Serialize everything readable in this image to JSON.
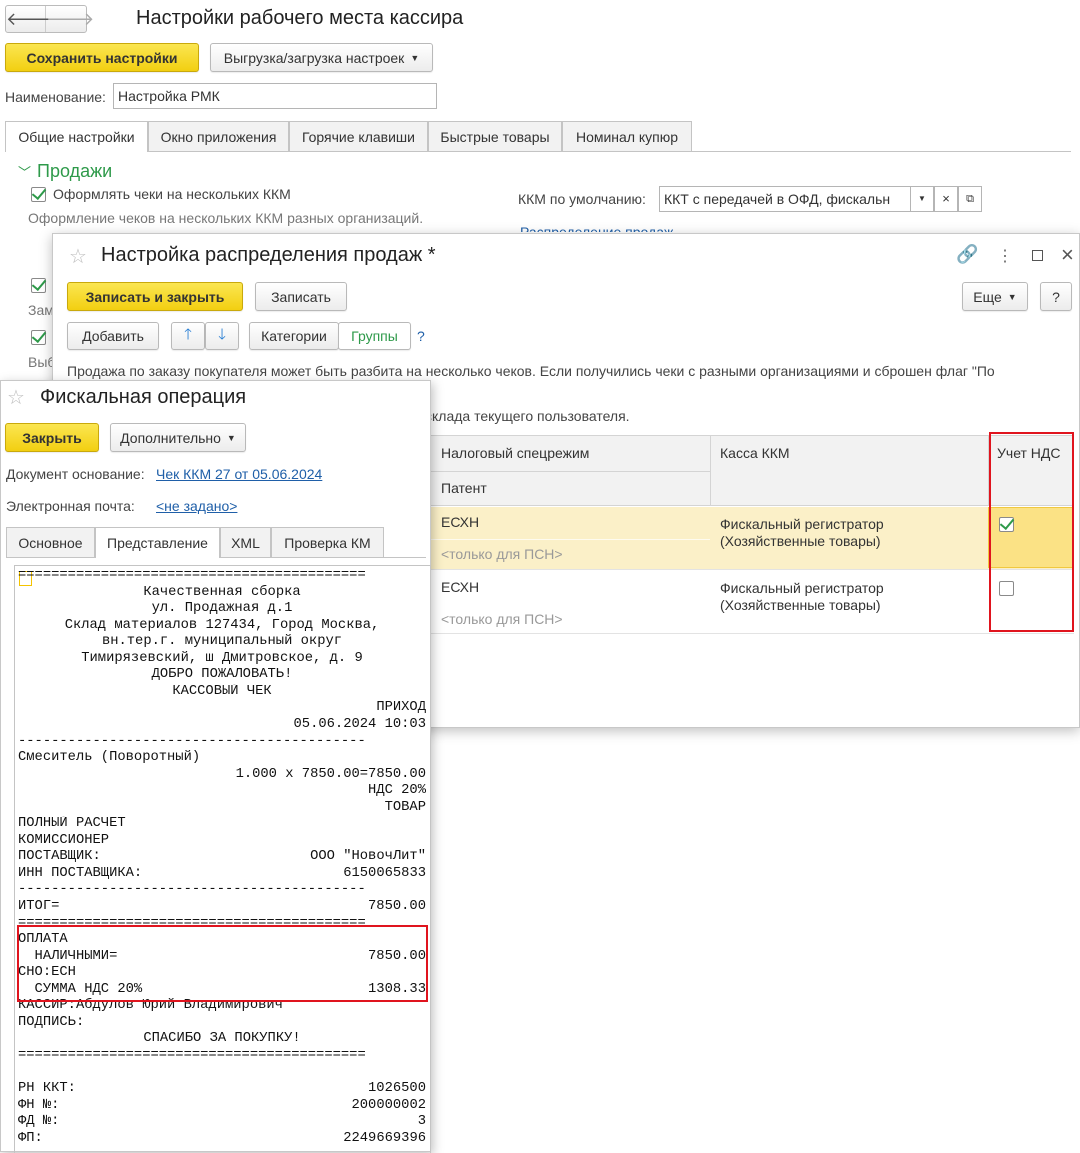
{
  "main": {
    "title": "Настройки рабочего места кассира",
    "save_label": "Сохранить настройки",
    "export_label": "Выгрузка/загрузка настроек",
    "name_label": "Наименование:",
    "name_value": "Настройка РМК",
    "tabs": [
      "Общие настройки",
      "Окно приложения",
      "Горячие клавиши",
      "Быстрые товары",
      "Номинал купюр"
    ],
    "section_title": "Продажи",
    "multi_kkm_label": "Оформлять чеки на нескольких ККМ",
    "multi_kkm_hint": "Оформление чеков на нескольких ККМ разных организаций.",
    "default_kkm_label": "ККМ по умолчанию:",
    "default_kkm_value": "ККТ с передачей в ОФД, фискальн",
    "partial_link": "Распределение продаж",
    "hidden_labels": [
      "Зам",
      "Выб"
    ]
  },
  "dist": {
    "title": "Настройка распределения продаж *",
    "write_close": "Записать и закрыть",
    "write": "Записать",
    "more": "Еще",
    "help": "?",
    "add": "Добавить",
    "categories": "Категории",
    "groups": "Группы",
    "q": "?",
    "info_line1": "Продажа по заказу покупателя может быть разбита на несколько чеков. Если получились чеки с разными организациями и сброшен флаг \"По",
    "info_line2": "склада текущего пользователя.",
    "columns": [
      "Налоговый спецрежим",
      "Касса ККМ",
      "Учет НДС"
    ],
    "subheader": "Патент",
    "rows": [
      {
        "regime": "ЕСХН",
        "patent": "<только для ПСН>",
        "kkm1": "Фискальный регистратор",
        "kkm2": "(Хозяйственные товары)",
        "vat": true
      },
      {
        "regime": "ЕСХН",
        "patent": "<только для ПСН>",
        "kkm1": "Фискальный регистратор",
        "kkm2": "(Хозяйственные товары)",
        "vat": false
      }
    ]
  },
  "fiscal": {
    "title": "Фискальная операция",
    "close": "Закрыть",
    "more": "Дополнительно",
    "doc_label": "Документ основание:",
    "doc_link": "Чек ККМ 27 от 05.06.2024",
    "email_label": "Электронная почта:",
    "email_link": "<не задано>",
    "tabs": [
      "Основное",
      "Представление",
      "XML",
      "Проверка КМ"
    ]
  },
  "receipt": [
    {
      "t": "==========================================",
      "a": "l"
    },
    {
      "t": "Качественная сборка",
      "a": "c"
    },
    {
      "t": "ул. Продажная д.1",
      "a": "c"
    },
    {
      "t": "Склад материалов 127434, Город Москва,",
      "a": "c"
    },
    {
      "t": "вн.тер.г. муниципальный округ",
      "a": "c"
    },
    {
      "t": "Тимирязевский, ш Дмитровское, д. 9",
      "a": "c"
    },
    {
      "t": "ДОБРО ПОЖАЛОВАТЬ!",
      "a": "c"
    },
    {
      "t": "КАССОВЫЙ ЧЕК",
      "a": "c"
    },
    {
      "t": "ПРИХОД",
      "a": "r"
    },
    {
      "t": "05.06.2024 10:03",
      "a": "r"
    },
    {
      "t": "------------------------------------------",
      "a": "l"
    },
    {
      "t": "Смеситель (Поворотный)",
      "a": "l"
    },
    {
      "t": "1.000 x 7850.00=7850.00",
      "a": "r"
    },
    {
      "t": "НДС 20%",
      "a": "r"
    },
    {
      "t": "ТОВАР",
      "a": "r"
    },
    {
      "t": "ПОЛНЫЙ РАСЧЕТ",
      "a": "l"
    },
    {
      "t": "КОМИССИОНЕР",
      "a": "l"
    },
    {
      "t": "ПОСТАВЩИК:",
      "a": "l",
      "r": "ООО \"НовочЛит\""
    },
    {
      "t": "ИНН ПОСТАВЩИКА:",
      "a": "l",
      "r": "6150065833"
    },
    {
      "t": "------------------------------------------",
      "a": "l"
    },
    {
      "t": "ИТОГ=",
      "a": "l",
      "r": "7850.00"
    },
    {
      "t": "==========================================",
      "a": "l"
    },
    {
      "t": "ОПЛАТА",
      "a": "l"
    },
    {
      "t": "  НАЛИЧНЫМИ=",
      "a": "l",
      "r": "7850.00"
    },
    {
      "t": "СНО:ЕСН",
      "a": "l"
    },
    {
      "t": "  СУММА НДС 20%",
      "a": "l",
      "r": "1308.33"
    },
    {
      "t": "КАССИР:Абдулов Юрий Владимирович",
      "a": "l"
    },
    {
      "t": "ПОДПИСЬ:",
      "a": "l"
    },
    {
      "t": "СПАСИБО ЗА ПОКУПКУ!",
      "a": "c"
    },
    {
      "t": "==========================================",
      "a": "l"
    },
    {
      "t": "",
      "a": "l"
    },
    {
      "t": "РН ККТ:",
      "a": "l",
      "r": "1026500"
    },
    {
      "t": "ФН №:",
      "a": "l",
      "r": "200000002"
    },
    {
      "t": "ФД №:",
      "a": "l",
      "r": "3"
    },
    {
      "t": "ФП:",
      "a": "l",
      "r": "2249669396"
    }
  ],
  "colors": {
    "accent_yellow": "#f5d116",
    "section_green": "#2e9a4a",
    "highlight_red": "#e0141e",
    "row_selected": "#fbf0c8"
  }
}
